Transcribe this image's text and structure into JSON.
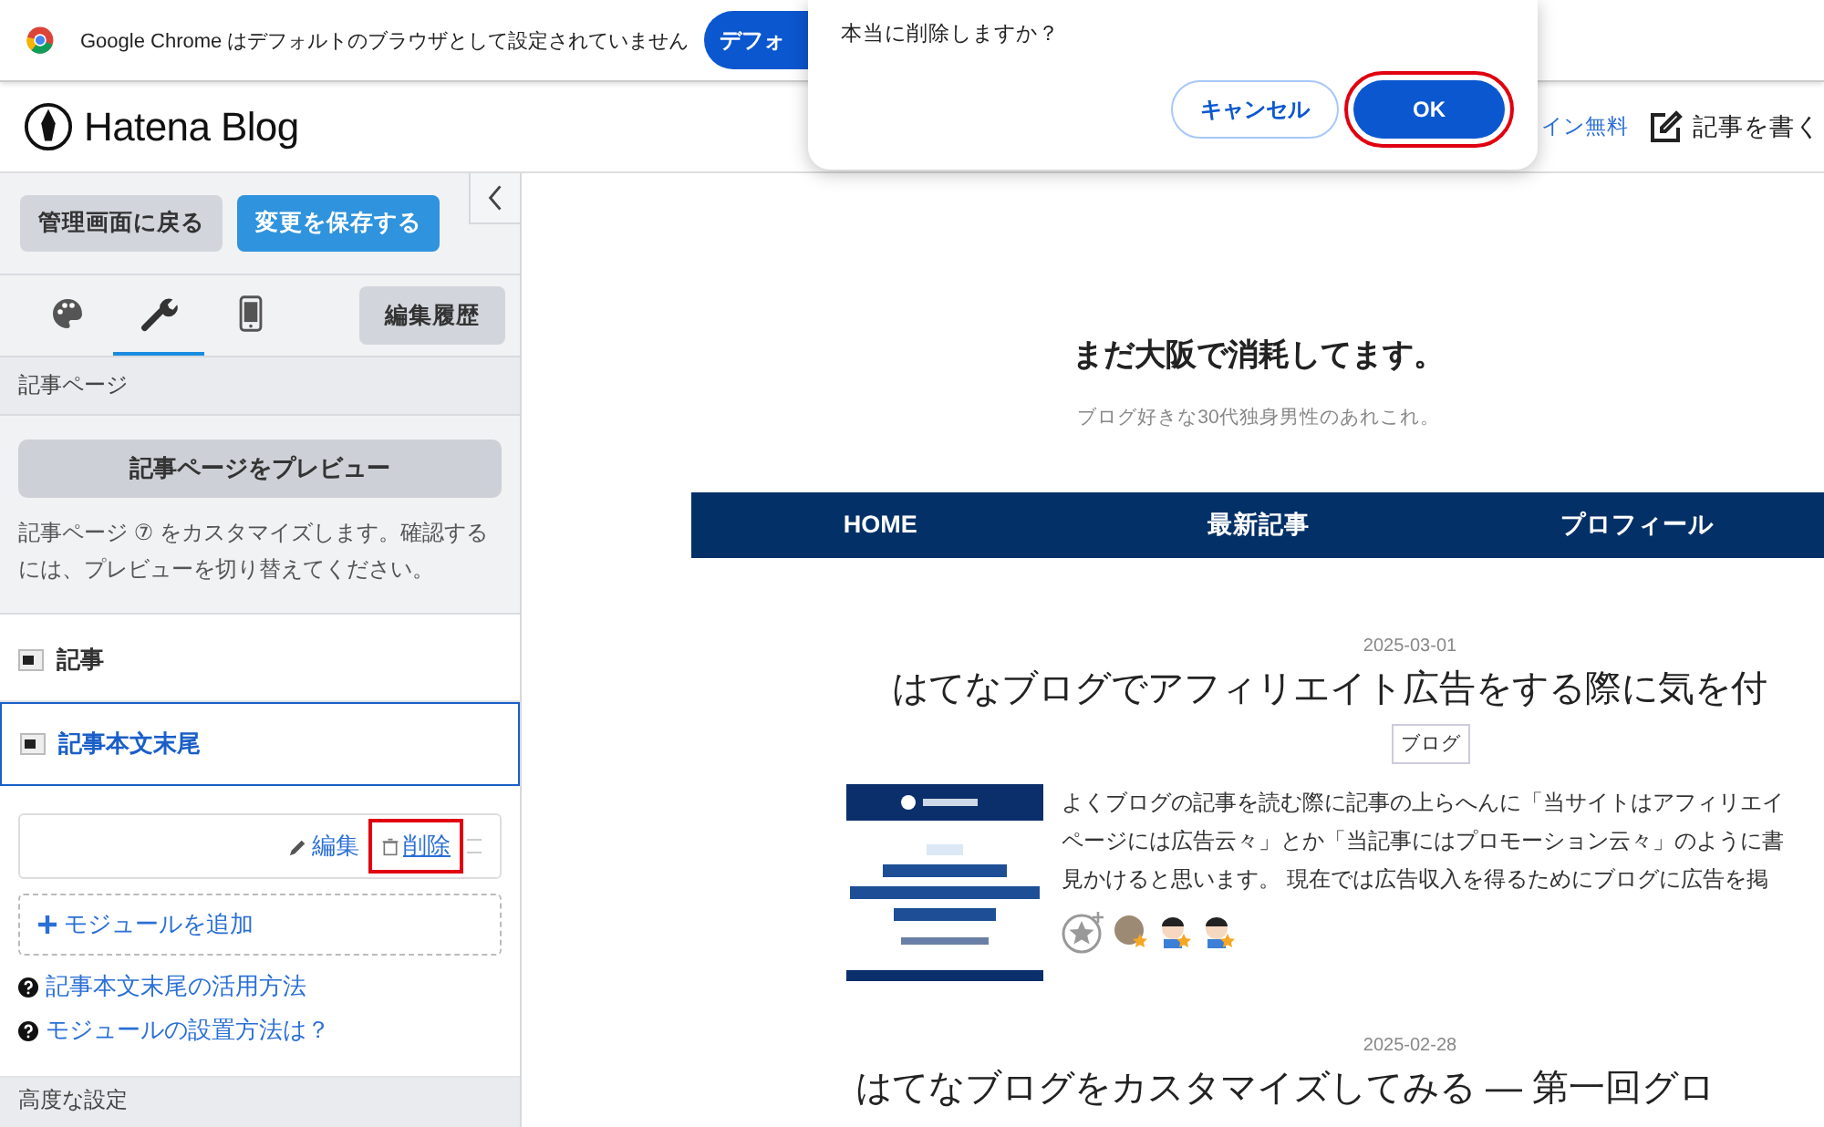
{
  "infobar": {
    "message": "Google Chrome はデフォルトのブラウザとして設定されていません",
    "button": "デフォ"
  },
  "header": {
    "logo": "Hatena Blog",
    "links": [
      "イン無料"
    ],
    "write_button": "記事を書く"
  },
  "dialog": {
    "message": "本当に削除しますか？",
    "buttons": [
      {
        "label": "キャンセル",
        "kind": "secondary",
        "highlighted": false
      },
      {
        "label": "OK",
        "kind": "primary",
        "highlighted": true
      }
    ]
  },
  "sidebar": {
    "back_button": "管理画面に戻る",
    "save_button": "変更を保存する",
    "history_button": "編集履歴",
    "tabs": [
      {
        "kind": "palette",
        "selected": false
      },
      {
        "kind": "wrench",
        "selected": true
      },
      {
        "kind": "phone",
        "selected": false
      }
    ],
    "section_title": "記事ページ",
    "preview_button": "記事ページをプレビュー",
    "description": "記事ページ ⑦ をカスタマイズします。確認するには、プレビューを切り替えてください。",
    "modules": [
      {
        "label": "記事",
        "selected": false
      },
      {
        "label": "記事本文末尾",
        "selected": true
      }
    ],
    "module_actions": [
      {
        "label": "編集",
        "kind": "edit"
      },
      {
        "label": "削除",
        "kind": "delete",
        "highlighted": true
      }
    ],
    "add_module": "モジュールを追加",
    "help_links": [
      "記事本文末尾の活用方法",
      "モジュールの設置方法は？"
    ],
    "advanced_title": "高度な設定"
  },
  "blog": {
    "title": "まだ大阪で消耗してます。",
    "tagline": "ブログ好きな30代独身男性のあれこれ。",
    "nav": [
      "HOME",
      "最新記事",
      "プロフィール"
    ],
    "posts": [
      {
        "date": "2025-03-01",
        "title": "はてなブログでアフィリエイト広告をする際に気を付",
        "category": "ブログ",
        "excerpt": [
          "よくブログの記事を読む際に記事の上らへんに「当サイトはアフィリエイ",
          "ページには広告云々」とか「当記事にはプロモーション云々」のように書",
          "見かけると思います。 現在では広告収入を得るためにブログに広告を掲"
        ]
      },
      {
        "date": "2025-02-28",
        "title": "はてなブログをカスタマイズしてみる — 第一回グロ"
      }
    ]
  }
}
